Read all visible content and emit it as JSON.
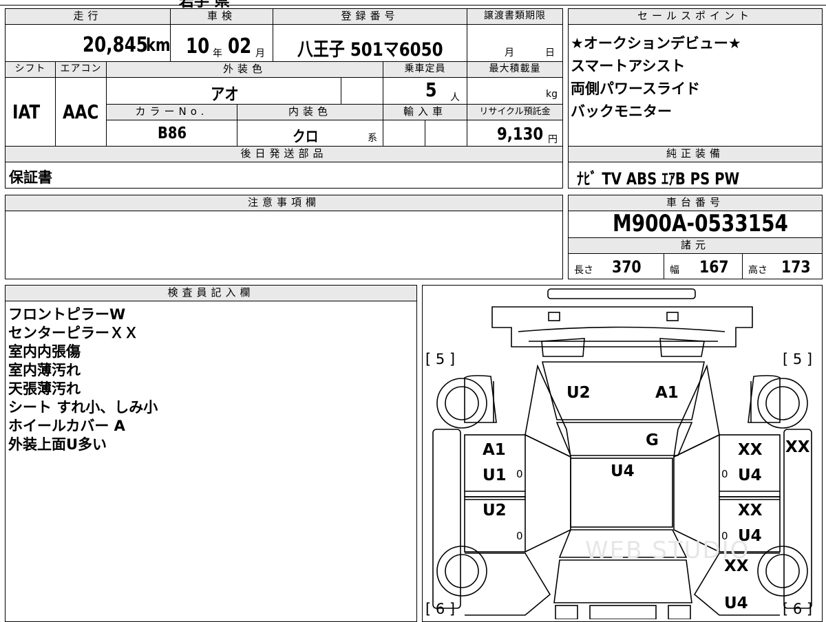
{
  "top_fragment": "岩手 県",
  "mileage": {
    "header": "走行",
    "value": "20,845",
    "unit": "km"
  },
  "inspection": {
    "header": "車検",
    "year": "10",
    "year_unit": "年",
    "month": "02",
    "month_unit": "月"
  },
  "registration": {
    "header": "登録番号",
    "value": "八王子 501マ6050"
  },
  "transfer_deadline": {
    "header": "譲渡書類期限",
    "month_unit": "月",
    "day_unit": "日"
  },
  "sales_points": {
    "header": "セールスポイント",
    "items": [
      "★オークションデビュー★",
      "スマートアシスト",
      "両側パワースライド",
      "バックモニター"
    ]
  },
  "shift": {
    "header": "シフト",
    "value": "IAT"
  },
  "aircon": {
    "header": "エアコン",
    "value": "AAC"
  },
  "exterior_color": {
    "header": "外装色",
    "value": "アオ"
  },
  "capacity": {
    "header": "乗車定員",
    "value": "5",
    "unit": "人"
  },
  "max_load": {
    "header": "最大積載量",
    "unit": "kg"
  },
  "color_no": {
    "header": "カラーNo.",
    "value": "B86"
  },
  "interior_color": {
    "header": "内装色",
    "value": "クロ",
    "suffix": "系"
  },
  "import": {
    "header": "輸入車"
  },
  "recycle_fee": {
    "header": "リサイクル預託金",
    "value": "9,130",
    "unit": "円"
  },
  "later_parts": {
    "header": "後日発送部品",
    "value": "保証書"
  },
  "genuine_equipment": {
    "header": "純正装備",
    "value": "ﾅﾋﾞ TV ABS ｴｱB PS PW"
  },
  "notes": {
    "header": "注意事項欄"
  },
  "chassis": {
    "header": "車台番号",
    "value": "M900A-0533154"
  },
  "specs": {
    "header": "諸元",
    "length_label": "長さ",
    "length": "370",
    "width_label": "幅",
    "width": "167",
    "height_label": "高さ",
    "height": "173"
  },
  "inspector": {
    "header": "検査員記入欄",
    "items": [
      "フロントピラーW",
      "センターピラーＸＸ",
      "室内内張傷",
      "室内薄汚れ",
      "天張薄汚れ",
      "シート すれ小、しみ小",
      "ホイールカバー A",
      "外装上面U多い"
    ]
  },
  "diagram": {
    "tire_front_left": "[ 5 ]",
    "tire_front_right": "[ 5 ]",
    "tire_rear_left": "[ 6 ]",
    "tire_rear_right": "[ 6 ]",
    "codes": {
      "hood_left": "U2",
      "hood_right": "A1",
      "windshield": "G",
      "roof": "U4",
      "left_front_door_1": "A1",
      "left_front_door_2": "U1",
      "left_rear_door": "U2",
      "right_front_door_1": "XX",
      "right_front_door_2": "U4",
      "right_rear_door_1": "XX",
      "right_rear_door_2": "U4",
      "right_pillar": "XX",
      "right_rear_fender": "XX",
      "right_rear_quarter": "U4"
    },
    "zero_mark": "0",
    "watermark": "WEB STUDIO"
  }
}
